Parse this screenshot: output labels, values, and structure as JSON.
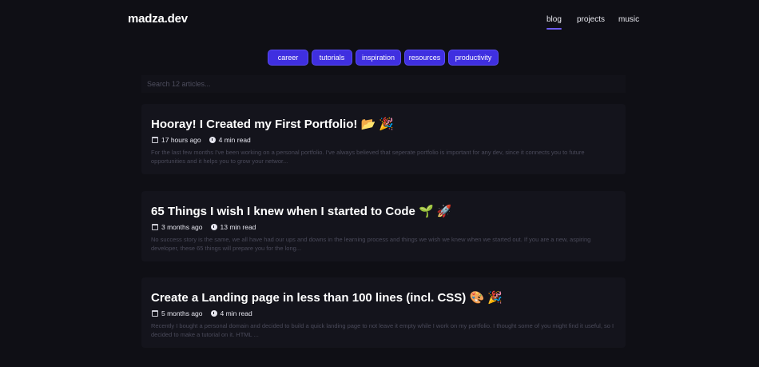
{
  "header": {
    "logo": "madza.dev",
    "nav": [
      {
        "label": "blog",
        "active": true
      },
      {
        "label": "projects",
        "active": false
      },
      {
        "label": "music",
        "active": false
      }
    ]
  },
  "tags": [
    "career",
    "tutorials",
    "inspiration",
    "resources",
    "productivity"
  ],
  "search": {
    "placeholder": "Search 12 articles..."
  },
  "articles": [
    {
      "title": "Hooray! I Created my First Portfolio! 📂 🎉",
      "date": "17 hours ago",
      "read": "4 min read",
      "excerpt": "For the last few months I've been working on a personal portfolio. I've always believed that seperate portfolio is important for any dev, since it connects you to future opportunities and it helps you to grow your networ..."
    },
    {
      "title": "65 Things I wish I knew when I started to Code 🌱 🚀",
      "date": "3 months ago",
      "read": "13 min read",
      "excerpt": "No success story is the same, we all have had our ups and downs in the learning process and things we wish we knew when we started out. If you are a new, aspiring developer, these 65 things will prepare you for the long..."
    },
    {
      "title": "Create a Landing page in less than 100 lines (incl. CSS) 🎨 🎉",
      "date": "5 months ago",
      "read": "4 min read",
      "excerpt": "Recently I bought a personal domain and decided to build a quick landing page to not leave it empty while I work on my portfolio. I thought some of you might find it useful, so I decided to make a tutorial on it. HTML ..."
    }
  ],
  "colors": {
    "accent": "#3f2fe0",
    "background": "#0f0f15",
    "card": "#14141c"
  }
}
